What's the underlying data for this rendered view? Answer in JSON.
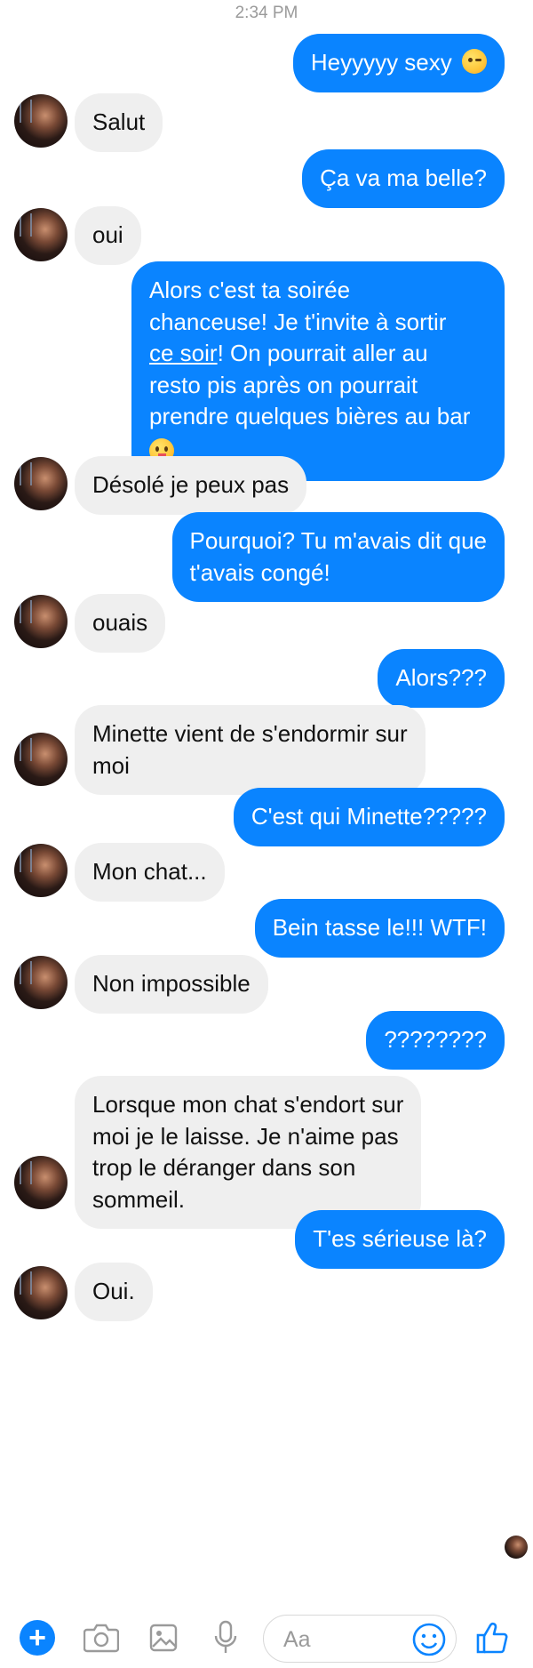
{
  "status": {
    "time": "2:34 PM"
  },
  "messages": [
    {
      "from": "me",
      "text": "Heyyyyy sexy",
      "emoji": "wink"
    },
    {
      "from": "them",
      "text": "Salut"
    },
    {
      "from": "me",
      "text": "Ça va ma belle?"
    },
    {
      "from": "them",
      "text": "oui"
    },
    {
      "from": "me",
      "lines": [
        "Alors c'est ta soirée",
        "chanceuse! Je t'invite à sortir",
        "ce soir",
        "! On pourrait aller au",
        "resto pis après on pourrait",
        "prendre quelques bières au bar"
      ],
      "emoji": "tongue"
    },
    {
      "from": "them",
      "text": "Désolé je peux pas"
    },
    {
      "from": "me",
      "lines": [
        "Pourquoi? Tu m'avais dit que",
        "t'avais congé!"
      ]
    },
    {
      "from": "them",
      "text": "ouais"
    },
    {
      "from": "me",
      "text": "Alors???"
    },
    {
      "from": "them",
      "lines": [
        "Minette vient de s'endormir sur",
        "moi"
      ]
    },
    {
      "from": "me",
      "text": "C'est qui Minette?????"
    },
    {
      "from": "them",
      "text": "Mon chat..."
    },
    {
      "from": "me",
      "text": "Bein tasse le!!! WTF!"
    },
    {
      "from": "them",
      "text": "Non impossible"
    },
    {
      "from": "me",
      "text": "????????"
    },
    {
      "from": "them",
      "lines": [
        "Lorsque mon chat s'endort sur",
        "moi je le laisse. Je n'aime pas",
        "trop le déranger dans son",
        "sommeil."
      ]
    },
    {
      "from": "me",
      "text": "T'es sérieuse là?"
    },
    {
      "from": "them",
      "text": "Oui."
    }
  ],
  "composer": {
    "placeholder": "Aa",
    "icons": [
      "plus-icon",
      "camera-icon",
      "gallery-icon",
      "microphone-icon",
      "smiley-icon",
      "thumbs-up-icon"
    ],
    "accent_color": "#0a84ff"
  },
  "colors": {
    "outgoing": "#0a84ff",
    "incoming": "#efefef"
  }
}
